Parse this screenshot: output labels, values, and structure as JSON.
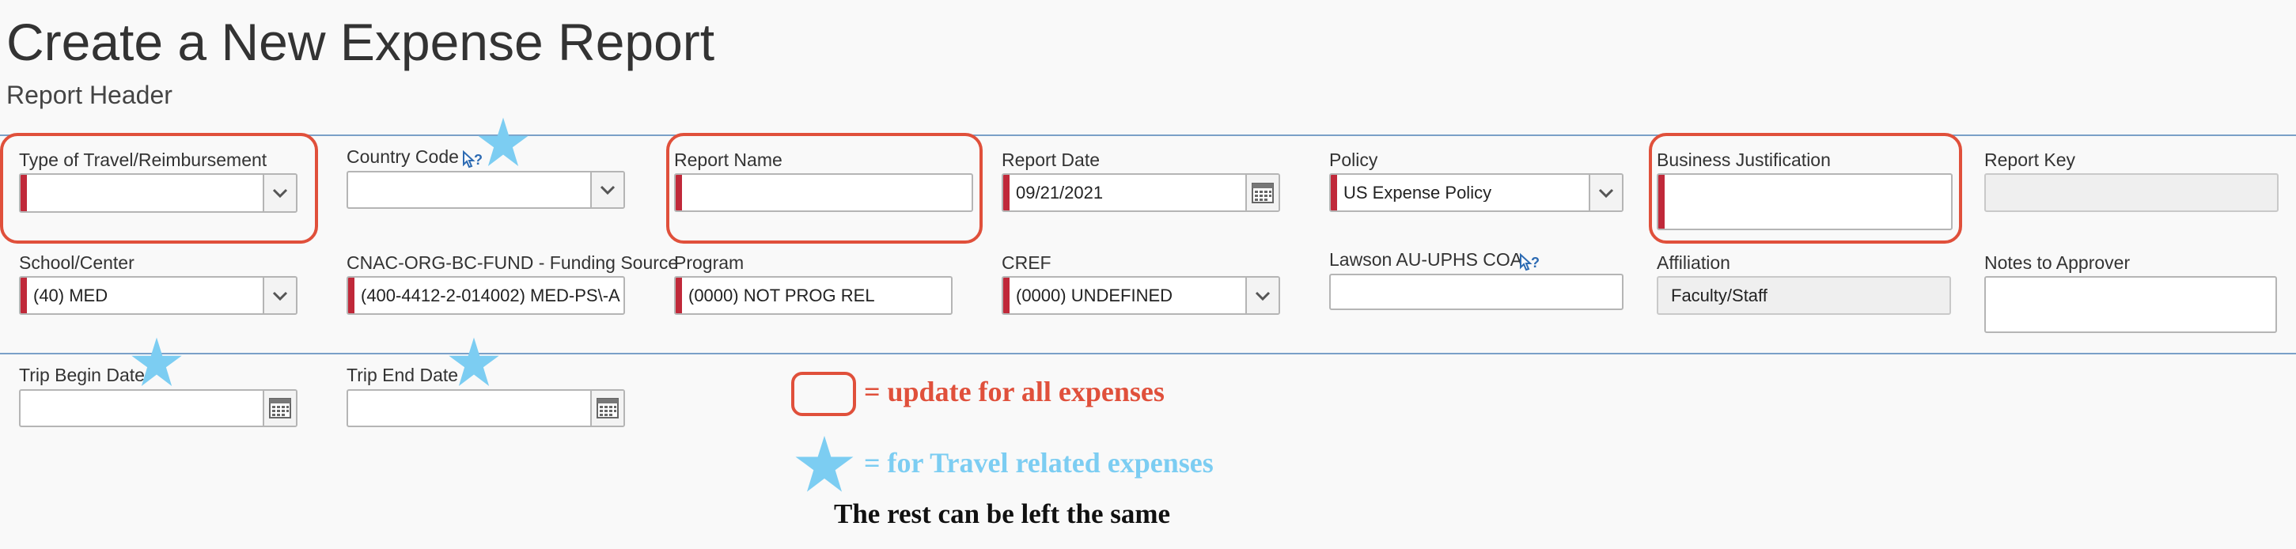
{
  "page": {
    "title": "Create a New Expense Report",
    "subtitle": "Report Header"
  },
  "fields": {
    "type_of_travel": {
      "label": "Type of Travel/Reimbursement",
      "value": ""
    },
    "country_code": {
      "label": "Country Code",
      "value": ""
    },
    "report_name": {
      "label": "Report Name",
      "value": ""
    },
    "report_date": {
      "label": "Report Date",
      "value": "09/21/2021"
    },
    "policy": {
      "label": "Policy",
      "value": "US Expense Policy"
    },
    "business_justification": {
      "label": "Business Justification",
      "value": ""
    },
    "report_key": {
      "label": "Report Key",
      "value": ""
    },
    "school_center": {
      "label": "School/Center",
      "value": "(40) MED"
    },
    "funding_source": {
      "label": "CNAC-ORG-BC-FUND - Funding Source",
      "value": "(400-4412-2-014002) MED-PS\\-A"
    },
    "program": {
      "label": "Program",
      "value": "(0000) NOT PROG REL"
    },
    "cref": {
      "label": "CREF",
      "value": "(0000) UNDEFINED"
    },
    "lawson_coa": {
      "label": "Lawson AU-UPHS COA",
      "value": ""
    },
    "affiliation": {
      "label": "Affiliation",
      "value": "Faculty/Staff"
    },
    "notes_to_approver": {
      "label": "Notes to Approver",
      "value": ""
    },
    "trip_begin_date": {
      "label": "Trip Begin Date",
      "value": ""
    },
    "trip_end_date": {
      "label": "Trip End Date",
      "value": ""
    }
  },
  "legend": {
    "update_all": "= update for all expenses",
    "travel_related": "= for Travel related expenses",
    "rest_same": "The rest can be left the same"
  },
  "colors": {
    "required_marker": "#c0293a",
    "annotation_box": "#e0503b",
    "star": "#7ccdf2",
    "legend_red": "#e0503b",
    "legend_blue": "#7ccdf2",
    "divider": "#7aa0c8"
  },
  "icons": [
    "chevron-down-icon",
    "calendar-icon",
    "help-icon",
    "star-icon"
  ]
}
